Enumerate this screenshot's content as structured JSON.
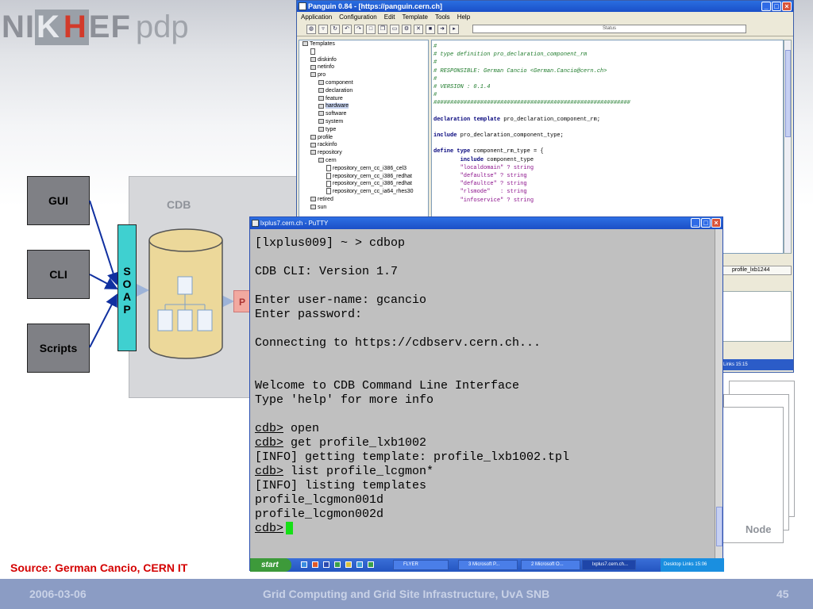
{
  "logo": {
    "pre": "NI",
    "k": "K",
    "h": "H",
    "post": "EF",
    "pdp": "pdp"
  },
  "diagram": {
    "clients": [
      "GUI",
      "CLI",
      "Scripts"
    ],
    "soap_letters": [
      "S",
      "O",
      "A",
      "P"
    ],
    "cdb_label": "CDB",
    "p_label": "P",
    "node_label": "Node"
  },
  "source": "Source: German Cancio, CERN IT",
  "footer": {
    "date": "2006-03-06",
    "title": "Grid Computing and Grid Site Infrastructure, UvA SNB",
    "page": "45"
  },
  "panguin": {
    "title": "Panguin 0.84 - [https://panguin.cern.ch]",
    "menu": [
      "Application",
      "Configuration",
      "Edit",
      "Template",
      "Tools",
      "Help"
    ],
    "status": "Status",
    "tree": [
      {
        "label": "Templates",
        "indent": 0
      },
      {
        "label": "",
        "indent": 1,
        "file": true
      },
      {
        "label": "diskinfo",
        "indent": 1
      },
      {
        "label": "netinfo",
        "indent": 1
      },
      {
        "label": "pro",
        "indent": 1
      },
      {
        "label": "component",
        "indent": 2
      },
      {
        "label": "declaration",
        "indent": 2
      },
      {
        "label": "feature",
        "indent": 2
      },
      {
        "label": "hardware",
        "indent": 2,
        "selected": true
      },
      {
        "label": "software",
        "indent": 2
      },
      {
        "label": "system",
        "indent": 2
      },
      {
        "label": "type",
        "indent": 2
      },
      {
        "label": "profile",
        "indent": 1
      },
      {
        "label": "rackinfo",
        "indent": 1
      },
      {
        "label": "repository",
        "indent": 1
      },
      {
        "label": "cern",
        "indent": 2
      },
      {
        "label": "repository_cern_cc_i386_cel3",
        "indent": 3,
        "file": true
      },
      {
        "label": "repository_cern_cc_i386_redhat",
        "indent": 3,
        "file": true
      },
      {
        "label": "repository_cern_cc_i386_redhat",
        "indent": 3,
        "file": true
      },
      {
        "label": "repository_cern_cc_ia64_rhes30",
        "indent": 3,
        "file": true
      },
      {
        "label": "retired",
        "indent": 1
      },
      {
        "label": "sun",
        "indent": 1
      }
    ],
    "editor": [
      [
        {
          "c": "cm",
          "t": "#"
        }
      ],
      [
        {
          "c": "cm",
          "t": "# type definition pro_declaration_component_rm"
        }
      ],
      [
        {
          "c": "cm",
          "t": "#"
        }
      ],
      [
        {
          "c": "cm",
          "t": "# RESPONSIBLE: German Cancio <German.Cancio@cern.ch>"
        }
      ],
      [
        {
          "c": "cm",
          "t": "#"
        }
      ],
      [
        {
          "c": "cm",
          "t": "# VERSION : 0.1.4"
        }
      ],
      [
        {
          "c": "cm",
          "t": "#"
        }
      ],
      [
        {
          "c": "cm",
          "t": "###########################################################"
        }
      ],
      [],
      [
        {
          "c": "kw",
          "t": "declaration template"
        },
        {
          "c": "pl",
          "t": " pro_declaration_component_rm;"
        }
      ],
      [],
      [
        {
          "c": "kw",
          "t": "include"
        },
        {
          "c": "pl",
          "t": " pro_declaration_component_type;"
        }
      ],
      [],
      [
        {
          "c": "kw",
          "t": "define type"
        },
        {
          "c": "pl",
          "t": " component_rm_type = {"
        }
      ],
      [
        {
          "c": "pl",
          "t": "        "
        },
        {
          "c": "kw",
          "t": "include"
        },
        {
          "c": "pl",
          "t": " component_type"
        }
      ],
      [
        {
          "c": "str",
          "t": "        \"localdomain\" ? string"
        }
      ],
      [
        {
          "c": "str",
          "t": "        \"defaultse\" ? string"
        }
      ],
      [
        {
          "c": "str",
          "t": "        \"defaultce\" ? string"
        }
      ],
      [
        {
          "c": "str",
          "t": "        \"rlsmode\"   : string"
        }
      ],
      [
        {
          "c": "str",
          "t": "        \"infoservice\" ? string"
        }
      ]
    ],
    "tab": "profile_lxb1244",
    "taskbar": "Links  15:15"
  },
  "putty": {
    "title": "lxplus7.cern.ch - PuTTY",
    "lines": [
      {
        "t": "[lxplus009] ~ > cdbop"
      },
      {
        "gap": true
      },
      {
        "t": "CDB CLI: Version 1.7"
      },
      {
        "gap": true
      },
      {
        "t": "Enter user-name: gcancio"
      },
      {
        "t": "Enter password:"
      },
      {
        "gap": true
      },
      {
        "t": "Connecting to https://cdbserv.cern.ch..."
      },
      {
        "gap": true
      },
      {
        "gap": true
      },
      {
        "t": "Welcome to CDB Command Line Interface"
      },
      {
        "t": "Type 'help' for more info"
      },
      {
        "gap": true
      },
      {
        "p": "cdb>",
        "t": " open"
      },
      {
        "p": "cdb>",
        "t": " get profile_lxb1002"
      },
      {
        "t": "[INFO] getting template: profile_lxb1002.tpl"
      },
      {
        "p": "cdb>",
        "t": " list profile_lcgmon*"
      },
      {
        "t": "[INFO] listing templates"
      },
      {
        "t": "profile_lcgmon001d"
      },
      {
        "t": "profile_lcgmon002d"
      },
      {
        "p": "cdb>",
        "t": "",
        "cursor": true
      }
    ],
    "taskbar": {
      "start": "start",
      "tasks": [
        "FLYER",
        "3 Microsoft P...",
        "2 Microsoft O...",
        "lxplus7.cern.ch..."
      ],
      "tray": "Desktop  Links  15:06"
    }
  }
}
